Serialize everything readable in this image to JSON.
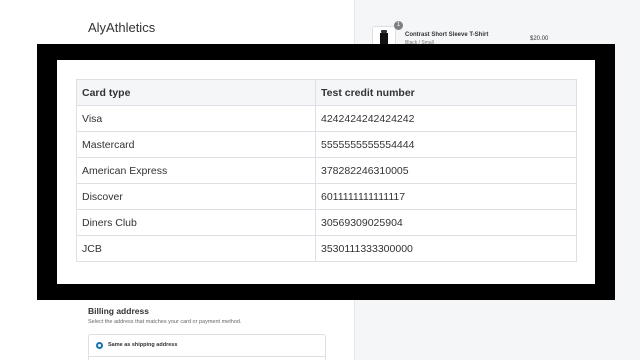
{
  "checkout": {
    "store_name": "AlyAthletics"
  },
  "order_summary": {
    "item": {
      "quantity": "1",
      "name": "Contrast Short Sleeve T-Shirt",
      "variant": "Black / Small",
      "price": "$20.00"
    }
  },
  "test_cards": {
    "headers": [
      "Card type",
      "Test credit number"
    ],
    "rows": [
      [
        "Visa",
        "4242424242424242"
      ],
      [
        "Mastercard",
        "5555555555554444"
      ],
      [
        "American Express",
        "378282246310005"
      ],
      [
        "Discover",
        "6011111111111117"
      ],
      [
        "Diners Club",
        "30569309025904"
      ],
      [
        "JCB",
        "3530111333300000"
      ]
    ]
  },
  "billing": {
    "title": "Billing address",
    "subtitle": "Select the address that matches your card or payment method.",
    "selected_option": "Same as shipping address"
  },
  "colors": {
    "accent": "#1773b0",
    "overlay": "#000000",
    "summary_bg": "#f4f6f8"
  }
}
